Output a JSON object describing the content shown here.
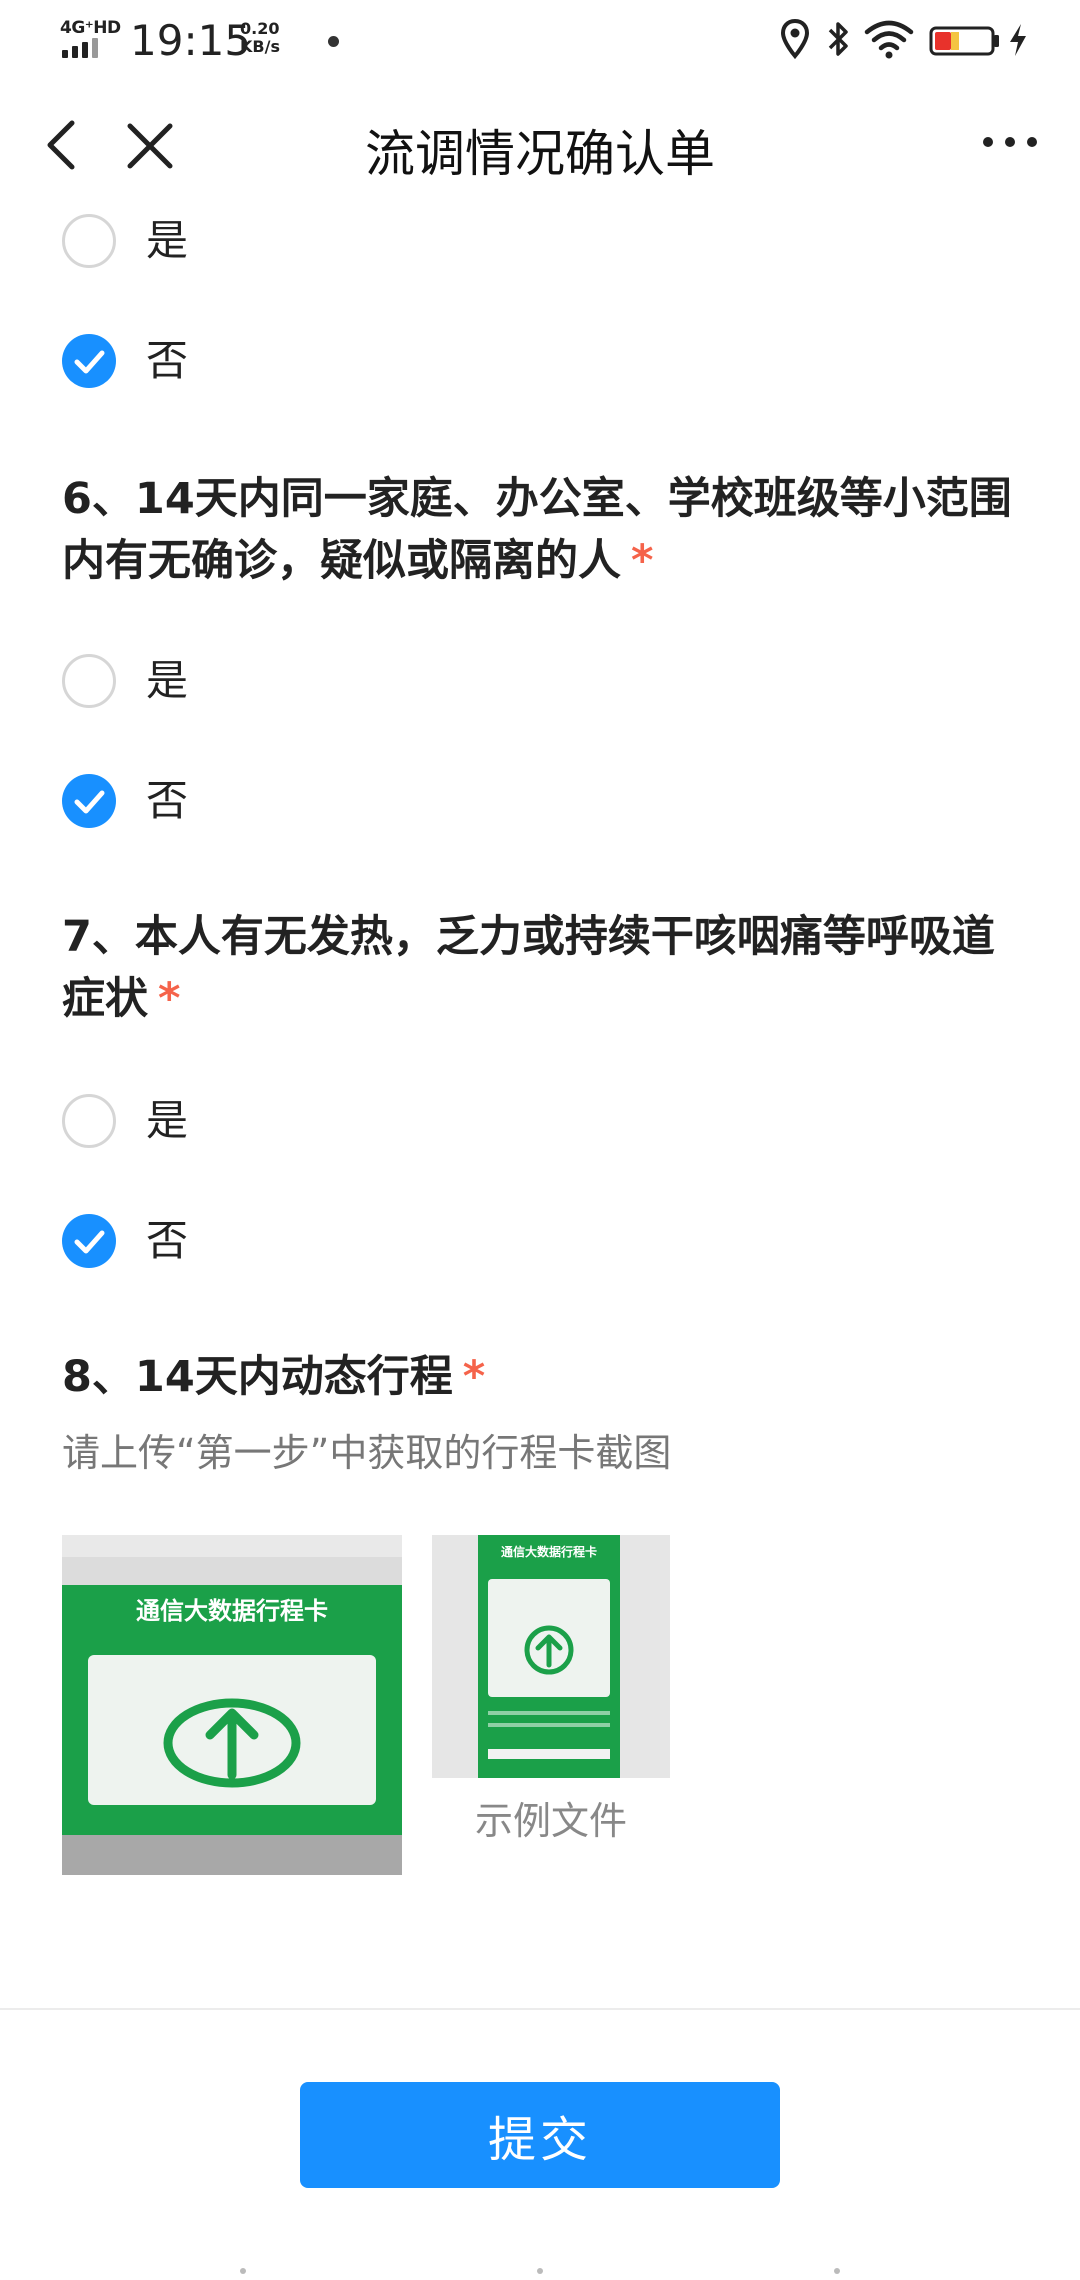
{
  "status_bar": {
    "network": "4G⁺HD",
    "time": "19:15",
    "speed_value": "0.20",
    "speed_unit": "KB/s",
    "icons": [
      "location-icon",
      "bluetooth-icon",
      "wifi-icon",
      "battery-icon",
      "charging-icon"
    ],
    "battery_color": "#e8322b"
  },
  "nav": {
    "title": "流调情况确认单",
    "back_icon": "chevron-left-icon",
    "close_icon": "close-icon",
    "more_icon": "more-icon"
  },
  "question5": {
    "options": [
      {
        "label": "是",
        "checked": false
      },
      {
        "label": "否",
        "checked": true
      }
    ]
  },
  "question6": {
    "title": "6、14天内同一家庭、办公室、学校班级等小范围内有无确诊，疑似或隔离的人",
    "required_mark": "*",
    "options": [
      {
        "label": "是",
        "checked": false
      },
      {
        "label": "否",
        "checked": true
      }
    ]
  },
  "question7": {
    "title": "7、本人有无发热，乏力或持续干咳咽痛等呼吸道症状",
    "required_mark": "*",
    "options": [
      {
        "label": "是",
        "checked": false
      },
      {
        "label": "否",
        "checked": true
      }
    ]
  },
  "question8": {
    "title": "8、14天内动态行程",
    "required_mark": "*",
    "hint": "请上传“第一步”中获取的行程卡截图",
    "uploaded_image": {
      "card_title": "通信大数据行程卡"
    },
    "example": {
      "card_title": "通信大数据行程卡",
      "caption": "示例文件"
    }
  },
  "submit": {
    "label": "提交"
  },
  "colors": {
    "accent": "#1890ff",
    "required": "#f5634a",
    "card_green": "#1ba049"
  }
}
